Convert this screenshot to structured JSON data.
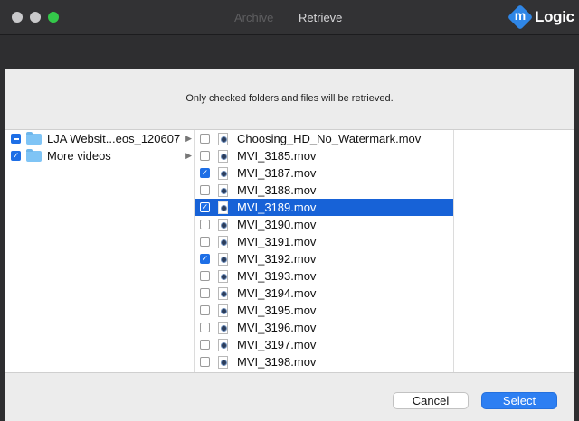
{
  "window": {
    "tabs": [
      {
        "label": "Archive",
        "active": false
      },
      {
        "label": "Retrieve",
        "active": true
      }
    ],
    "logo": {
      "badge": "m",
      "text": "Logic"
    }
  },
  "sheet": {
    "instruction": "Only checked folders and files will be retrieved.",
    "folders": [
      {
        "label": "LJA Websit...eos_120607",
        "state": "mixed",
        "selected": false
      },
      {
        "label": "More videos",
        "state": "checked",
        "selected": false
      }
    ],
    "files": [
      {
        "label": "Choosing_HD_No_Watermark.mov",
        "checked": false,
        "selected": false
      },
      {
        "label": "MVI_3185.mov",
        "checked": false,
        "selected": false
      },
      {
        "label": "MVI_3187.mov",
        "checked": true,
        "selected": false
      },
      {
        "label": "MVI_3188.mov",
        "checked": false,
        "selected": false
      },
      {
        "label": "MVI_3189.mov",
        "checked": true,
        "selected": true
      },
      {
        "label": "MVI_3190.mov",
        "checked": false,
        "selected": false
      },
      {
        "label": "MVI_3191.mov",
        "checked": false,
        "selected": false
      },
      {
        "label": "MVI_3192.mov",
        "checked": true,
        "selected": false
      },
      {
        "label": "MVI_3193.mov",
        "checked": false,
        "selected": false
      },
      {
        "label": "MVI_3194.mov",
        "checked": false,
        "selected": false
      },
      {
        "label": "MVI_3195.mov",
        "checked": false,
        "selected": false
      },
      {
        "label": "MVI_3196.mov",
        "checked": false,
        "selected": false
      },
      {
        "label": "MVI_3197.mov",
        "checked": false,
        "selected": false
      },
      {
        "label": "MVI_3198.mov",
        "checked": false,
        "selected": false
      }
    ],
    "buttons": {
      "cancel": "Cancel",
      "select": "Select"
    }
  },
  "colors": {
    "accent": "#1762d7",
    "select_button": "#2d7ff2",
    "traffic_max": "#34c84a"
  }
}
